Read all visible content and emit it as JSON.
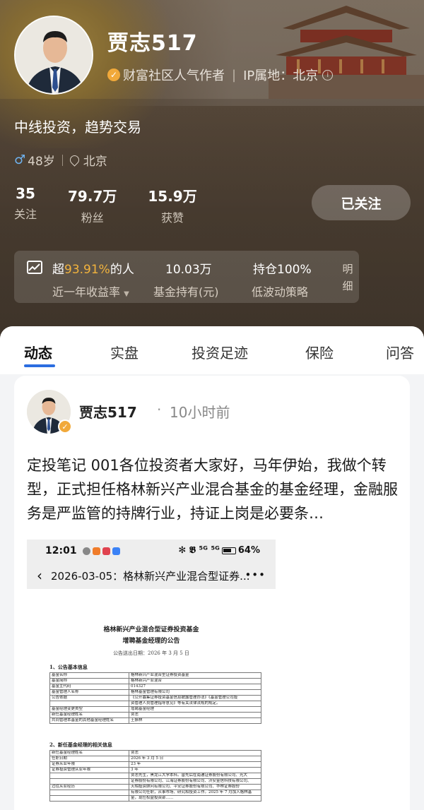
{
  "profile": {
    "name": "贾志517",
    "badge_text": "财富社区人气作者",
    "ip_label": "IP属地：北京",
    "motto": "中线投资，趋势交易",
    "age": "48岁",
    "location": "北京"
  },
  "stats": [
    {
      "value": "35",
      "label": "关注"
    },
    {
      "value": "79.7万",
      "label": "粉丝"
    },
    {
      "value": "15.9万",
      "label": "获赞"
    }
  ],
  "follow_button": "已关注",
  "performance": {
    "return_prefix": "超",
    "return_pct": "93.91%",
    "return_suffix": "的人",
    "return_label": "近一年收益率",
    "holding_value": "10.03万",
    "holding_label": "基金持有(元)",
    "position_value": "持仓100%",
    "position_label": "低波动策略",
    "detail_label": "明细"
  },
  "tabs": [
    "动态",
    "实盘",
    "投资足迹",
    "保险",
    "问答"
  ],
  "post": {
    "author": "贾志517",
    "dot": "·",
    "time": "10小时前",
    "text": "定投笔记 001各位投资者大家好，马年伊始，我做个转型，正式担任格林新兴产业混合基金的基金经理，金融服务是严监管的持牌行业，持证上岗是必要条…",
    "screenshot": {
      "time": "12:01",
      "status_right": "✻ 𝕭 ⁵ᴳ ⁵ᴳ",
      "battery": "64%",
      "nav_title": "2026-03-05：格林新兴产业混合型证券...",
      "doc_title_1": "格林新兴产业混合型证券投资基金",
      "doc_title_2": "增聘基金经理的公告",
      "doc_date": "公告送出日期：2026 年 3 月 5 日",
      "section_1": "1、公告基本信息",
      "table_1": [
        [
          "基金名称",
          "格林新兴产业混合型证券投资基金"
        ],
        [
          "基金简称",
          "格林新兴产业混合"
        ],
        [
          "基金主代码",
          "014327"
        ],
        [
          "基金管理人名称",
          "格林基金管理有限公司"
        ],
        [
          "公告依据",
          "《公开募集证券投资基金信息披露管理办法》《基金管理公司投"
        ],
        [
          "",
          "资管理人员管理指导意见》等有关法律法规的规定。"
        ],
        [
          "基金经理变更类型",
          "增聘基金经理"
        ],
        [
          "新任基金经理姓名",
          "贾志"
        ],
        [
          "共同管理本基金的其他基金经理姓名",
          "王振林"
        ]
      ],
      "section_2": "2、新任基金经理的相关信息",
      "table_2": [
        [
          "新任基金经理姓名",
          "贾志"
        ],
        [
          "任职日期",
          "2026 年 3 月 5 日"
        ],
        [
          "证券从业年限",
          "23 年"
        ],
        [
          "证券投资管理从业年限",
          "3 年"
        ],
        [
          "",
          "贾志先生，黑龙江大学本科。曾先后在南通证券股份有限公司、光大"
        ],
        [
          "",
          "证券股份有限公司、江海证券股份有限公司、济安金信科技有限公司、"
        ],
        [
          "过往从业经历",
          "天相投资顾问有限公司、平安证券股份有限公司、华林证券股份"
        ],
        [
          "",
          "有限公司任职，从事市场、研究和投资工作。2025 年 7 月加入格林基"
        ],
        [
          "",
          "金，现任权益投资部……"
        ]
      ]
    }
  },
  "colors": {
    "accent_blue": "#2b6de0",
    "highlight_gold": "#f2b33d",
    "badge_orange": "#f1a93a"
  }
}
